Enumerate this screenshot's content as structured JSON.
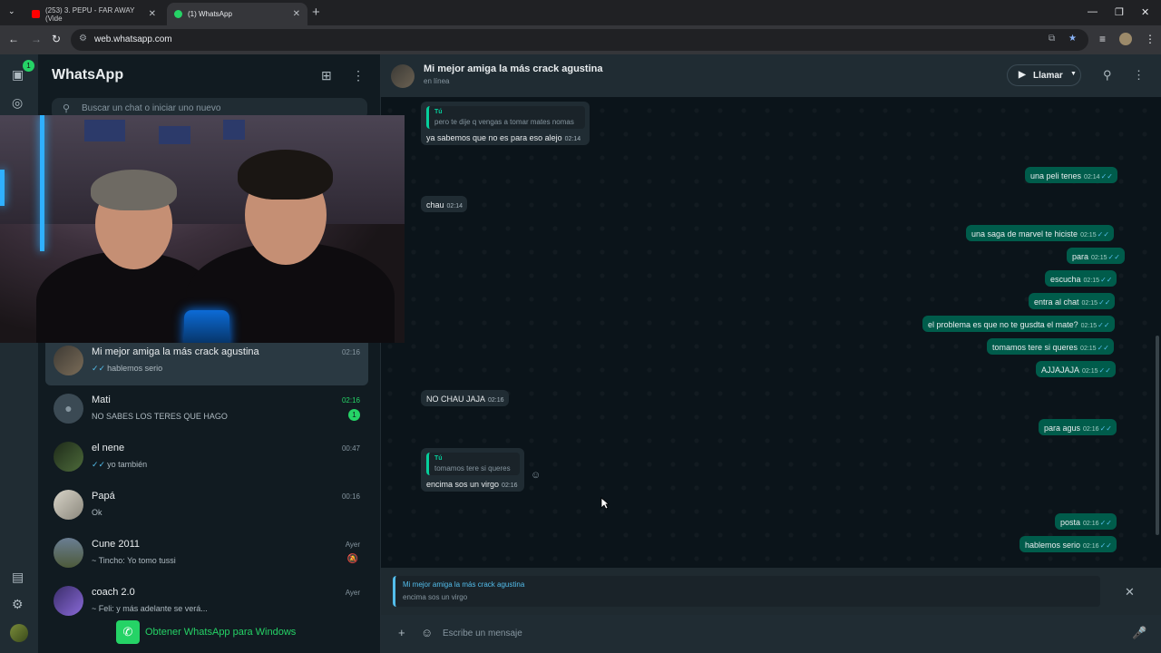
{
  "browser": {
    "tabs": [
      {
        "title": "(253) 3. PEPU - FAR AWAY (Vide"
      },
      {
        "title": "(1) WhatsApp"
      }
    ],
    "url": "web.whatsapp.com"
  },
  "rail": {
    "badge": "1"
  },
  "sidebar": {
    "title": "WhatsApp",
    "search_placeholder": "Buscar un chat o iniciar uno nuevo",
    "chats": [
      {
        "name": "Mi mejor amiga la más crack agustina",
        "time": "02:16",
        "last": "hablemos serio",
        "ticks": "✓✓"
      },
      {
        "name": "Mati",
        "time": "02:16",
        "last": "NO SABES LOS TERES QUE HAGO",
        "unread": "1"
      },
      {
        "name": "el nene",
        "time": "00:47",
        "last": "yo también",
        "ticks": "✓✓"
      },
      {
        "name": "Papá",
        "time": "00:16",
        "last": "Ok"
      },
      {
        "name": "Cune 2011",
        "time": "Ayer",
        "last": "~ Tincho: Yo tomo tussi"
      },
      {
        "name": "coach 2.0",
        "time": "Ayer",
        "last": "~ Feli: y más adelante se verá..."
      }
    ],
    "get_app": "Obtener WhatsApp para Windows"
  },
  "conversation": {
    "name": "Mi mejor amiga la más crack agustina",
    "status": "en línea",
    "call_label": "Llamar",
    "messages": [
      {
        "dir": "in",
        "quote_name": "Tú",
        "quote_text": "pero te dije q vengas a tomar mates nomas",
        "text": "ya sabemos que no es para eso alejo",
        "time": "02:14"
      },
      {
        "dir": "out",
        "text": "una peli tenes",
        "time": "02:14"
      },
      {
        "dir": "in",
        "text": "chau",
        "time": "02:14"
      },
      {
        "dir": "out",
        "text": "una saga de marvel te hiciste",
        "time": "02:15"
      },
      {
        "dir": "out",
        "text": "para",
        "time": "02:15"
      },
      {
        "dir": "out",
        "text": "escucha",
        "time": "02:15"
      },
      {
        "dir": "out",
        "text": "entra al chat",
        "time": "02:15"
      },
      {
        "dir": "out",
        "text": "el problema es que no te gusdta el mate?",
        "time": "02:15"
      },
      {
        "dir": "out",
        "text": "tomamos tere si queres",
        "time": "02:15"
      },
      {
        "dir": "out",
        "text": "AJJAJAJA",
        "time": "02:15"
      },
      {
        "dir": "in",
        "text": "NO CHAU JAJA",
        "time": "02:16"
      },
      {
        "dir": "out",
        "text": "para agus",
        "time": "02:16"
      },
      {
        "dir": "in",
        "quote_name": "Tú",
        "quote_text": "tomamos tere si queres",
        "text": "encima sos un virgo",
        "time": "02:16"
      },
      {
        "dir": "out",
        "text": "posta",
        "time": "02:16"
      },
      {
        "dir": "out",
        "text": "hablemos serio",
        "time": "02:16"
      }
    ],
    "reply": {
      "name": "Mi mejor amiga la más crack agustina",
      "text": "encima sos un virgo"
    },
    "composer_placeholder": "Escribe un mensaje"
  },
  "icons": {
    "tick": "double-check-icon",
    "colors": {
      "accent": "#25d366",
      "bubble_out": "#005c4b",
      "bubble_in": "#202c33"
    }
  }
}
